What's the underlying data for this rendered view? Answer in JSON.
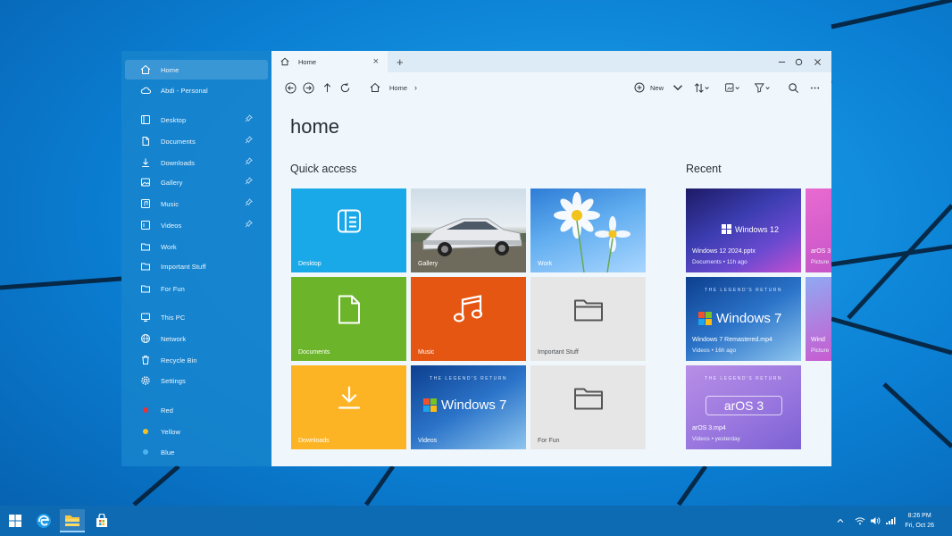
{
  "colors": {
    "accent": "#0b7fd3",
    "tile_desktop": "#1aa9e8",
    "tile_documents": "#6cb52a",
    "tile_music": "#e55612",
    "tile_downloads": "#fdb424",
    "tile_folder": "#e6e6e6",
    "tag_red": "#e8323c",
    "tag_yellow": "#f6c025",
    "tag_blue": "#49b3f1"
  },
  "sidebar": {
    "items": [
      {
        "label": "Home",
        "icon": "home-icon",
        "selected": true
      },
      {
        "label": "Abdi - Personal",
        "icon": "cloud-icon"
      },
      {
        "label": "Desktop",
        "icon": "desktop-icon",
        "pinned": true
      },
      {
        "label": "Documents",
        "icon": "document-icon",
        "pinned": true
      },
      {
        "label": "Downloads",
        "icon": "download-icon",
        "pinned": true
      },
      {
        "label": "Gallery",
        "icon": "image-icon",
        "pinned": true
      },
      {
        "label": "Music",
        "icon": "music-icon",
        "pinned": true
      },
      {
        "label": "Videos",
        "icon": "video-icon",
        "pinned": true
      },
      {
        "label": "Work",
        "icon": "folder-icon"
      },
      {
        "label": "Important Stuff",
        "icon": "folder-icon"
      },
      {
        "label": "For Fun",
        "icon": "folder-icon"
      },
      {
        "label": "This PC",
        "icon": "monitor-icon"
      },
      {
        "label": "Network",
        "icon": "globe-icon"
      },
      {
        "label": "Recycle Bin",
        "icon": "trash-icon"
      },
      {
        "label": "Settings",
        "icon": "gear-icon"
      },
      {
        "label": "Red",
        "icon": "tag-dot-icon",
        "color": "#e8323c"
      },
      {
        "label": "Yellow",
        "icon": "tag-dot-icon",
        "color": "#f6c025"
      },
      {
        "label": "Blue",
        "icon": "tag-dot-icon",
        "color": "#49b3f1"
      }
    ]
  },
  "tab": {
    "label": "Home",
    "close": "×",
    "new": "+"
  },
  "toolbar": {
    "breadcrumb": "Home",
    "breadcrumb_sep": "›",
    "new_label": "New"
  },
  "main": {
    "title": "home",
    "quick_access_title": "Quick access",
    "recent_title": "Recent",
    "tiles": [
      {
        "label": "Desktop"
      },
      {
        "label": "Gallery"
      },
      {
        "label": "Work"
      },
      {
        "label": "Documents"
      },
      {
        "label": "Music"
      },
      {
        "label": "Important Stuff"
      },
      {
        "label": "Downloads"
      },
      {
        "label": "Videos",
        "thumb_text": "Windows 7",
        "thumb_sub": "THE LEGEND'S RETURN"
      },
      {
        "label": "For Fun"
      }
    ],
    "recent": [
      {
        "name": "Windows 12 2024.pptx",
        "meta": "Documents  •  11h ago",
        "thumb_text": "Windows 12"
      },
      {
        "name": "Windows 7 Remastered.mp4",
        "meta": "Videos  •  16h ago",
        "thumb_text": "Windows 7",
        "thumb_sub": "THE LEGEND'S RETURN"
      },
      {
        "name": "arOS 3.mp4",
        "meta": "Videos  •  yesterday",
        "thumb_text": "arOS 3",
        "thumb_sub": "THE LEGEND'S RETURN"
      }
    ],
    "recent_partial": [
      {
        "name": "arOS 3",
        "meta": "Picture"
      },
      {
        "name": "Wind",
        "meta": "Picture"
      }
    ]
  },
  "taskbar": {
    "time": "8:26 PM",
    "date": "Fri, Oct 26"
  }
}
